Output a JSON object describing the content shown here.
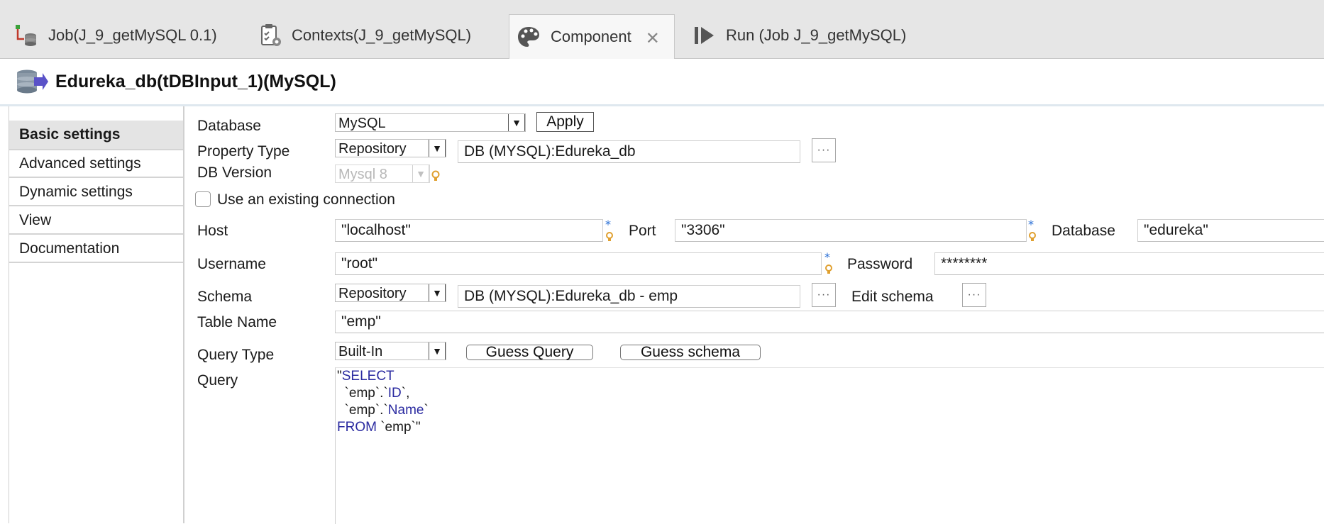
{
  "tabs": [
    {
      "label": "Job(J_9_getMySQL 0.1)",
      "icon": "job-icon"
    },
    {
      "label": "Contexts(J_9_getMySQL)",
      "icon": "contexts-icon"
    },
    {
      "label": "Component",
      "icon": "palette-icon",
      "active": true
    },
    {
      "label": "Run (Job J_9_getMySQL)",
      "icon": "run-icon"
    }
  ],
  "header": {
    "title": "Edureka_db(tDBInput_1)(MySQL)",
    "icon": "database-input-icon"
  },
  "sidebar": {
    "items": [
      {
        "label": "Basic settings",
        "active": true
      },
      {
        "label": "Advanced settings"
      },
      {
        "label": "Dynamic settings"
      },
      {
        "label": "View"
      },
      {
        "label": "Documentation"
      }
    ]
  },
  "form": {
    "database_label": "Database",
    "database_value": "MySQL",
    "apply_label": "Apply",
    "property_type_label": "Property Type",
    "property_type_value": "Repository",
    "property_repo_value": "DB (MYSQL):Edureka_db",
    "db_version_label": "DB Version",
    "db_version_value": "Mysql 8",
    "use_existing_label": "Use an existing connection",
    "host_label": "Host",
    "host_value": "\"localhost\"",
    "port_label": "Port",
    "port_value": "\"3306\"",
    "database2_label": "Database",
    "database2_value": "\"edureka\"",
    "username_label": "Username",
    "username_value": "\"root\"",
    "password_label": "Password",
    "password_value": "********",
    "schema_label": "Schema",
    "schema_value": "Repository",
    "schema_repo_value": "DB (MYSQL):Edureka_db - emp",
    "edit_schema_label": "Edit schema",
    "table_name_label": "Table Name",
    "table_name_value": "\"emp\"",
    "query_type_label": "Query Type",
    "query_type_value": "Built-In",
    "guess_query_label": "Guess Query",
    "guess_schema_label": "Guess schema",
    "query_label": "Query",
    "dots": "···"
  },
  "query": {
    "q0": "\"",
    "select_kw": "SELECT",
    "l1a": "  `emp`.`",
    "l1b": "ID",
    "l1c": "`,",
    "l2a": "  `emp`.`",
    "l2b": "Name",
    "l2c": "`",
    "from_kw": "FROM",
    "l3": " `emp`\""
  },
  "colors": {
    "keyword": "#2a2aa0",
    "hint_star": "#2a6fd6",
    "hint_bulb": "#e0a030"
  }
}
